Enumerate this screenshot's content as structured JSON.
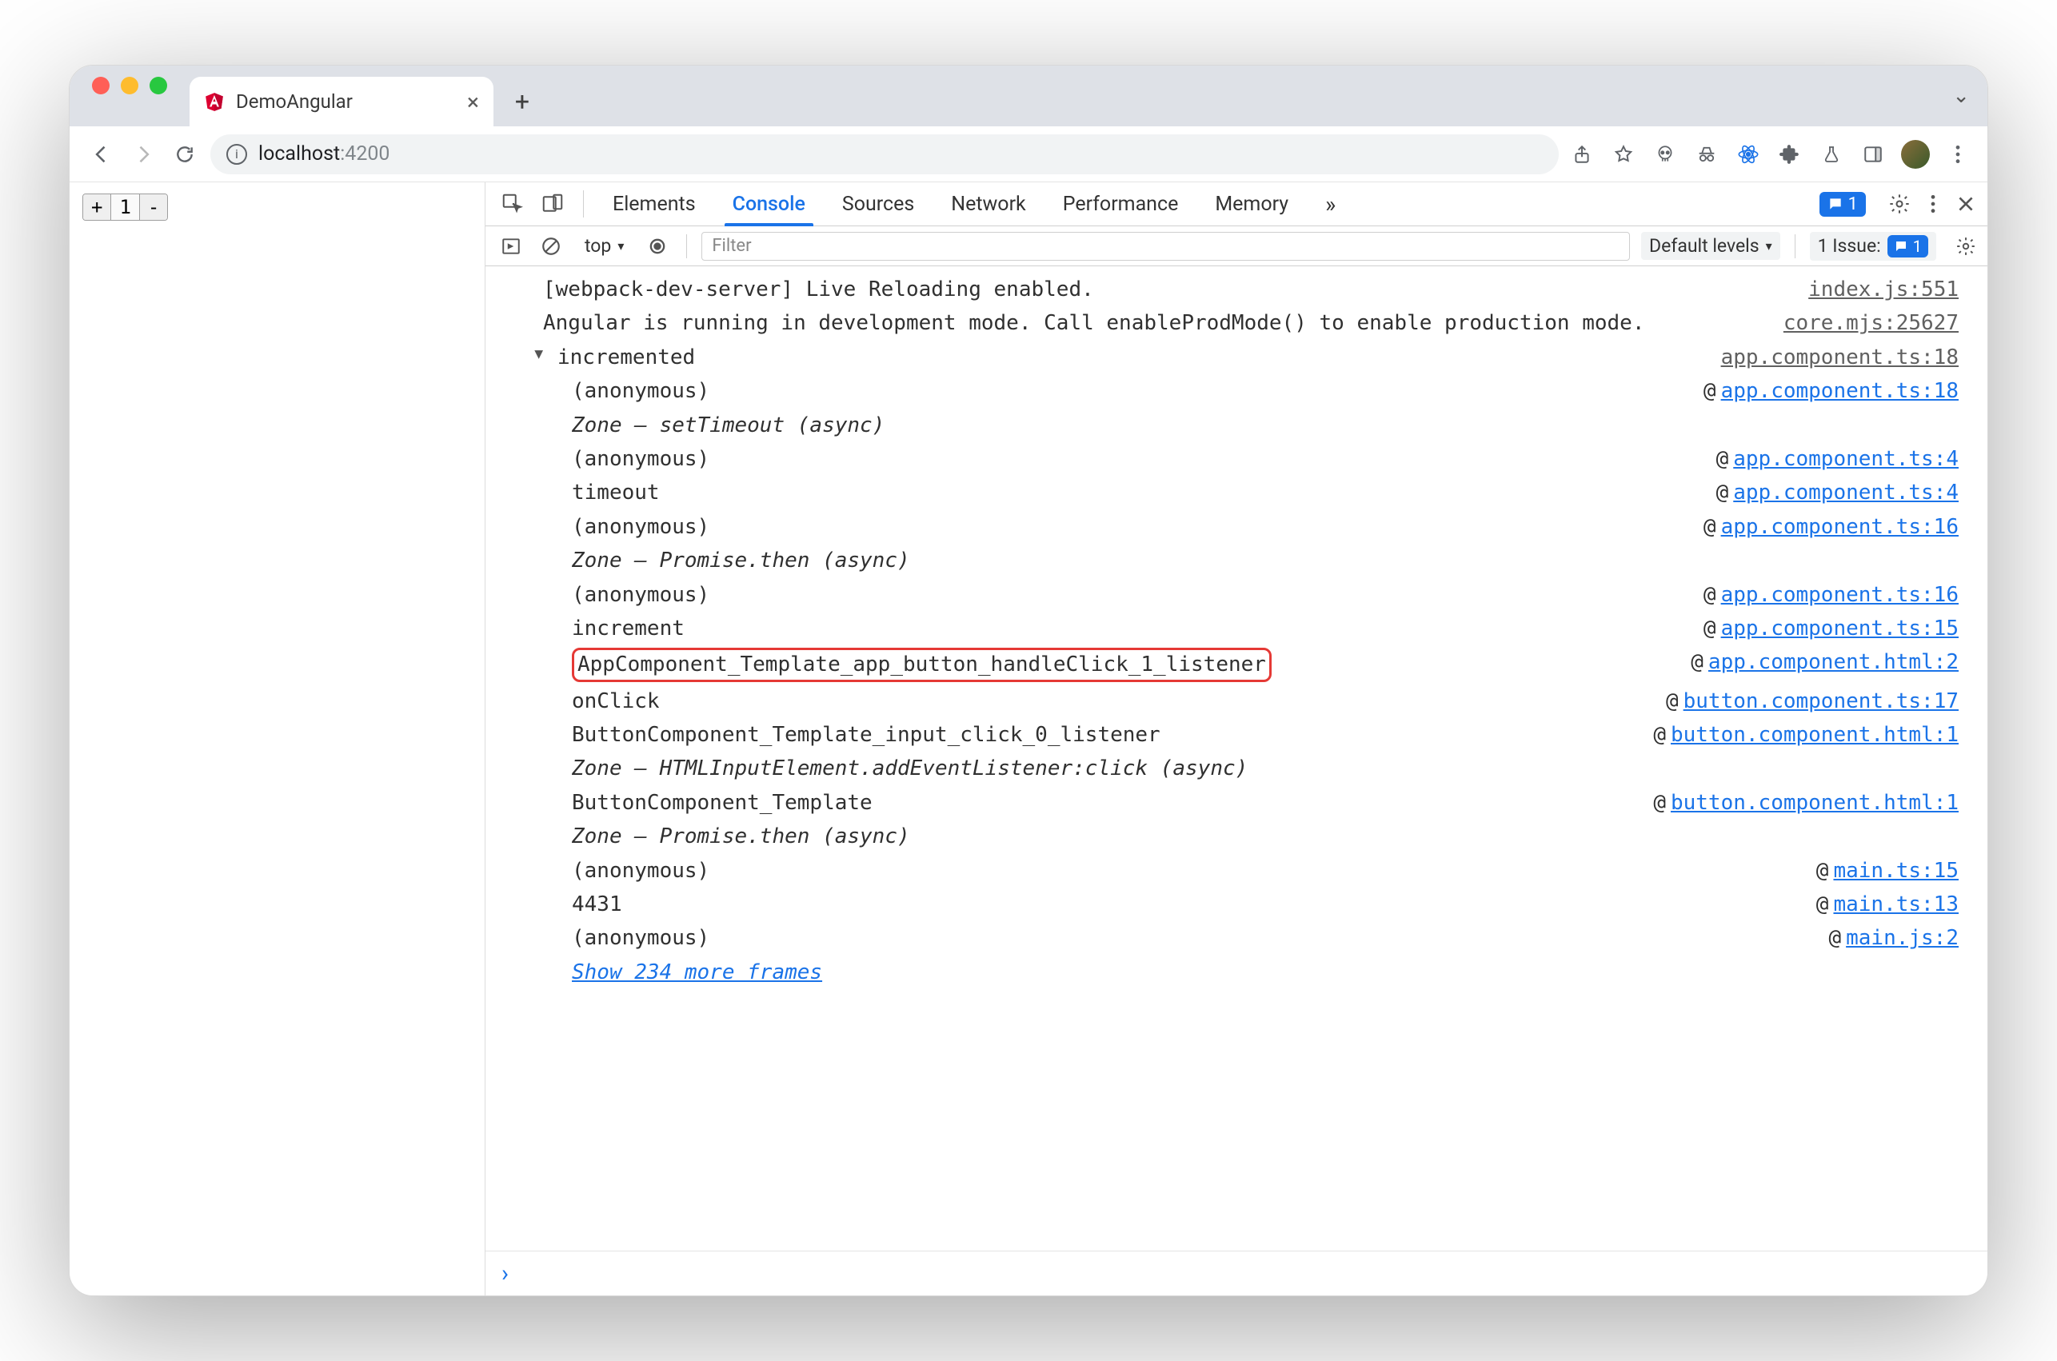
{
  "browser": {
    "tab_title": "DemoAngular",
    "url_host": "localhost",
    "url_port": ":4200",
    "new_tab_glyph": "+",
    "close_tab_glyph": "×",
    "chevron_glyph": "⌄"
  },
  "page": {
    "counter_plus": "+",
    "counter_value": "1",
    "counter_minus": "-"
  },
  "devtools": {
    "tabs": [
      "Elements",
      "Console",
      "Sources",
      "Network",
      "Performance",
      "Memory"
    ],
    "active_tab": "Console",
    "overflow_glyph": "»",
    "badge_count": "1",
    "toolbar": {
      "context": "top",
      "context_arrow": "▾",
      "filter_placeholder": "Filter",
      "levels": "Default levels",
      "levels_arrow": "▾",
      "issues_label": "1 Issue:",
      "issues_count": "1"
    }
  },
  "console": {
    "rows": [
      {
        "msg": "[webpack-dev-server] Live Reloading enabled.",
        "src": "index.js:551"
      },
      {
        "msg": "Angular is running in development mode. Call enableProdMode() to enable production mode.",
        "src": "core.mjs:25627"
      }
    ],
    "group": {
      "title": "incremented",
      "src": "app.component.ts:18",
      "frames": [
        {
          "fn": "(anonymous)",
          "loc": "app.component.ts:18"
        },
        {
          "fn": "Zone — setTimeout (async)",
          "italic": true
        },
        {
          "fn": "(anonymous)",
          "loc": "app.component.ts:4"
        },
        {
          "fn": "timeout",
          "loc": "app.component.ts:4"
        },
        {
          "fn": "(anonymous)",
          "loc": "app.component.ts:16"
        },
        {
          "fn": "Zone — Promise.then (async)",
          "italic": true
        },
        {
          "fn": "(anonymous)",
          "loc": "app.component.ts:16"
        },
        {
          "fn": "increment",
          "loc": "app.component.ts:15"
        },
        {
          "fn": "AppComponent_Template_app_button_handleClick_1_listener",
          "loc": "app.component.html:2",
          "highlight": true
        },
        {
          "fn": "onClick",
          "loc": "button.component.ts:17"
        },
        {
          "fn": "ButtonComponent_Template_input_click_0_listener",
          "loc": "button.component.html:1"
        },
        {
          "fn": "Zone — HTMLInputElement.addEventListener:click (async)",
          "italic": true
        },
        {
          "fn": "ButtonComponent_Template",
          "loc": "button.component.html:1"
        },
        {
          "fn": "Zone — Promise.then (async)",
          "italic": true
        },
        {
          "fn": "(anonymous)",
          "loc": "main.ts:15"
        },
        {
          "fn": "4431",
          "loc": "main.ts:13"
        },
        {
          "fn": "(anonymous)",
          "loc": "main.js:2"
        }
      ],
      "show_more": "Show 234 more frames"
    },
    "prompt_glyph": "›"
  }
}
